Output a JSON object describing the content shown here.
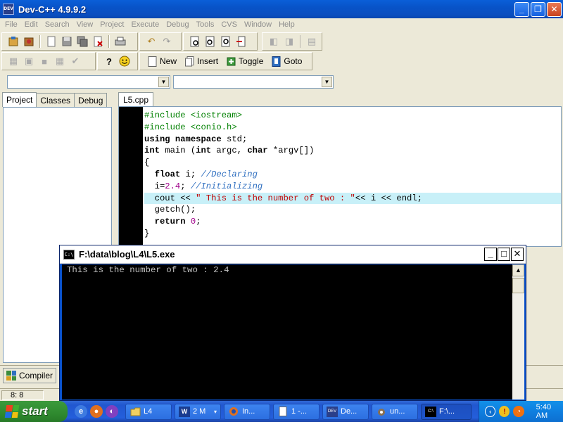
{
  "window": {
    "title": "Dev-C++ 4.9.9.2",
    "icon_text": "DEV"
  },
  "menu": [
    "File",
    "Edit",
    "Search",
    "View",
    "Project",
    "Execute",
    "Debug",
    "Tools",
    "CVS",
    "Window",
    "Help"
  ],
  "toolbar2": {
    "new_label": "New",
    "insert_label": "Insert",
    "toggle_label": "Toggle",
    "goto_label": "Goto"
  },
  "left_tabs": [
    "Project",
    "Classes",
    "Debug"
  ],
  "editor": {
    "tab": "L5.cpp",
    "lines": [
      "#include <iostream>",
      "#include <conio.h>",
      "using namespace std;",
      "int main (int argc, char *argv[])",
      "{",
      "  float i; //Declaring",
      "  i=2.4; //Initializing",
      "  cout << \" This is the number of two : \"<< i << endl;",
      "  getch();",
      "  return 0;",
      "}"
    ],
    "highlighted_line": 8
  },
  "compiler_tab": "Compiler",
  "status": {
    "position": "8: 8"
  },
  "console": {
    "title": "F:\\data\\blog\\L4\\L5.exe",
    "icon_text": "C:\\",
    "output": "This is the number of two : 2.4"
  },
  "taskbar": {
    "start_label": "start",
    "tasks": [
      {
        "label": "L4",
        "icon": "folder-icon"
      },
      {
        "label": "2 M",
        "icon": "word-icon"
      },
      {
        "label": "In...",
        "icon": "firefox-icon"
      },
      {
        "label": "1 -...",
        "icon": "document-icon"
      },
      {
        "label": "De...",
        "icon": "devcpp-icon"
      },
      {
        "label": "un...",
        "icon": "gimp-icon"
      },
      {
        "label": "F:\\...",
        "icon": "console-icon"
      }
    ],
    "clock": "5:40 AM"
  },
  "colors": {
    "titlebar": "#0a5fd8",
    "taskbar": "#245edb",
    "start": "#3c9a3c",
    "highlight_line": "#c8f0f8"
  }
}
